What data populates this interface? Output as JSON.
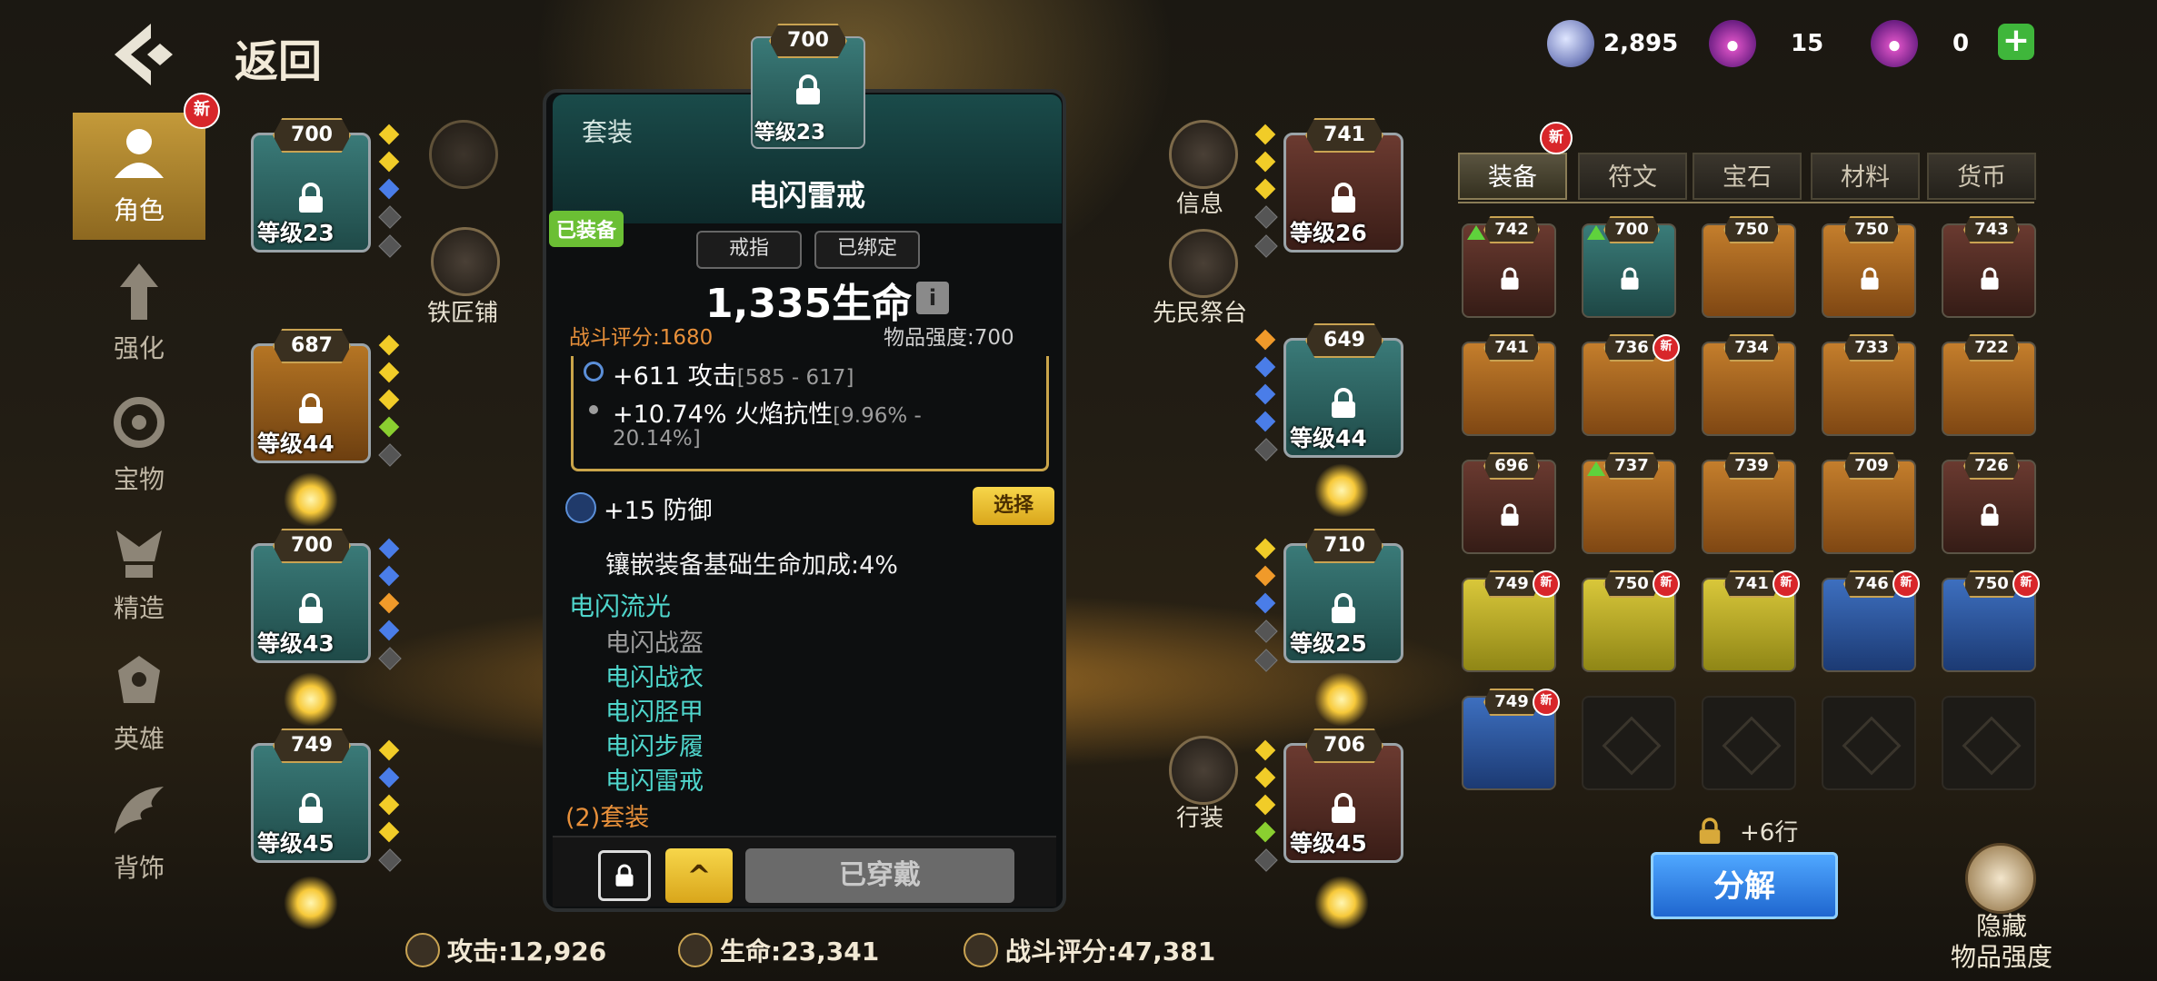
{
  "header": {
    "back_label": "返回"
  },
  "currency": [
    {
      "icon": "crystal-coin-icon",
      "value": "2,895"
    },
    {
      "icon": "pearl-shell-icon",
      "value": "15"
    },
    {
      "icon": "pearl-shell-icon",
      "value": "0"
    }
  ],
  "nav": {
    "items": [
      {
        "label": "角色",
        "icon": "character-icon",
        "active": true,
        "badge": "新"
      },
      {
        "label": "强化",
        "icon": "upgrade-icon"
      },
      {
        "label": "宝物",
        "icon": "treasure-icon"
      },
      {
        "label": "精造",
        "icon": "forge-icon"
      },
      {
        "label": "英雄",
        "icon": "hero-icon"
      },
      {
        "label": "背饰",
        "icon": "wings-icon"
      }
    ]
  },
  "left_slots": [
    {
      "power": "700",
      "level": "等级23"
    },
    {
      "power": "687",
      "level": "等级44"
    },
    {
      "power": "700",
      "level": "等级43"
    },
    {
      "power": "749",
      "level": "等级45"
    }
  ],
  "right_slots": [
    {
      "power": "741",
      "level": "等级26"
    },
    {
      "power": "649",
      "level": "等级44"
    },
    {
      "power": "710",
      "level": "等级25"
    },
    {
      "power": "706",
      "level": "等级45"
    }
  ],
  "side_buttons": {
    "blacksmith": "铁匠铺",
    "info": "信息",
    "altar": "先民祭台",
    "luggage": "行装"
  },
  "tooltip": {
    "set_tab": "套装",
    "preview_power": "700",
    "preview_level": "等级23",
    "item_name": "电闪雷戒",
    "equipped_badge": "已装备",
    "type_pill": "戒指",
    "bound_pill": "已绑定",
    "main_stat": "1,335生命",
    "combat_score": "战斗评分:1680",
    "item_strength": "物品强度:700",
    "stat1": "+611 攻击",
    "stat1_range": "[585 - 617]",
    "stat2": "+10.74% 火焰抗性",
    "stat2_range_a": "[9.96% -",
    "stat2_range_b": "20.14%]",
    "socket": "+15 防御",
    "choose_btn": "选择",
    "socket_bonus": "镶嵌装备基础生命加成:4%",
    "set_name": "电闪流光",
    "set_items": [
      "电闪战盔",
      "电闪战衣",
      "电闪胫甲",
      "电闪步履",
      "电闪雷戒"
    ],
    "set_bonus": "(2)套装",
    "action_wear": "已穿戴"
  },
  "inventory": {
    "tabs": [
      "装备",
      "符文",
      "宝石",
      "材料",
      "货币"
    ],
    "tab_badge": "新",
    "items": [
      {
        "power": "742",
        "rarity": "brown",
        "locked": true,
        "up": true
      },
      {
        "power": "700",
        "rarity": "teal",
        "locked": true,
        "up": true
      },
      {
        "power": "750",
        "rarity": "orange"
      },
      {
        "power": "750",
        "rarity": "orange",
        "locked": true
      },
      {
        "power": "743",
        "rarity": "brown",
        "locked": true
      },
      {
        "power": "741",
        "rarity": "orange"
      },
      {
        "power": "736",
        "rarity": "orange",
        "new": true
      },
      {
        "power": "734",
        "rarity": "orange"
      },
      {
        "power": "733",
        "rarity": "orange"
      },
      {
        "power": "722",
        "rarity": "orange"
      },
      {
        "power": "696",
        "rarity": "brown",
        "locked": true
      },
      {
        "power": "737",
        "rarity": "orange",
        "up": true
      },
      {
        "power": "739",
        "rarity": "orange"
      },
      {
        "power": "709",
        "rarity": "orange"
      },
      {
        "power": "726",
        "rarity": "brown",
        "locked": true
      },
      {
        "power": "749",
        "rarity": "yellow",
        "new": true
      },
      {
        "power": "750",
        "rarity": "yellow",
        "new": true
      },
      {
        "power": "741",
        "rarity": "yellow",
        "new": true
      },
      {
        "power": "746",
        "rarity": "blue",
        "new": true
      },
      {
        "power": "750",
        "rarity": "blue",
        "new": true
      },
      {
        "power": "749",
        "rarity": "blue",
        "new": true
      },
      {
        "power": "",
        "rarity": "empty"
      },
      {
        "power": "",
        "rarity": "empty"
      },
      {
        "power": "",
        "rarity": "empty"
      },
      {
        "power": "",
        "rarity": "empty"
      }
    ],
    "more_rows": "+6行",
    "decompose_btn": "分解",
    "hide_strength_line1": "隐藏",
    "hide_strength_line2": "物品强度"
  },
  "footer": {
    "attack": "攻击:12,926",
    "hp": "生命:23,341",
    "score": "战斗评分:47,381"
  },
  "colors": {
    "accent_gold": "#c9a352",
    "set_name_cyan": "#4fd6cc",
    "set_bonus_orange": "#e8903a"
  }
}
